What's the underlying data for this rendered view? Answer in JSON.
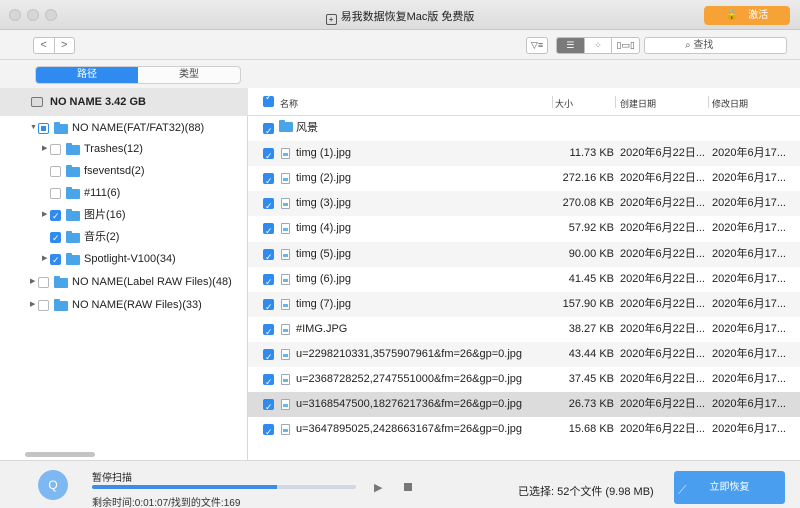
{
  "window": {
    "title": "易我数据恢复Mac版 免费版",
    "activate_label": "激活"
  },
  "toolbar": {
    "back": "<",
    "forward": ">",
    "filter_icon": "filter-icon",
    "view_modes": [
      "list-view-icon",
      "grid-view-icon",
      "column-view-icon"
    ],
    "search_placeholder": "查找"
  },
  "tabs": [
    "路径",
    "类型"
  ],
  "drive": {
    "label": "NO NAME 3.42 GB"
  },
  "tree": [
    {
      "label": "NO NAME(FAT/FAT32)(88)",
      "check": "partial",
      "expanded": true
    },
    {
      "label": "Trashes(12)",
      "check": "none",
      "expanded": false
    },
    {
      "label": "fseventsd(2)",
      "check": "none"
    },
    {
      "label": "#111(6)",
      "check": "none"
    },
    {
      "label": "图片(16)",
      "check": "on",
      "expanded": false
    },
    {
      "label": "音乐(2)",
      "check": "on"
    },
    {
      "label": "Spotlight-V100(34)",
      "check": "on",
      "expanded": false
    },
    {
      "label": "NO NAME(Label RAW Files)(48)",
      "check": "none",
      "expanded": false
    },
    {
      "label": "NO NAME(RAW Files)(33)",
      "check": "none",
      "expanded": false
    }
  ],
  "columns": {
    "name": "名称",
    "size": "大小",
    "created": "创建日期",
    "modified": "修改日期"
  },
  "files": [
    {
      "name": "风景",
      "type": "folder",
      "size": "",
      "created": "",
      "modified": ""
    },
    {
      "name": "timg (1).jpg",
      "type": "file",
      "size": "11.73 KB",
      "created": "2020年6月22日...",
      "modified": "2020年6月17..."
    },
    {
      "name": "timg (2).jpg",
      "type": "file",
      "size": "272.16 KB",
      "created": "2020年6月22日...",
      "modified": "2020年6月17..."
    },
    {
      "name": "timg (3).jpg",
      "type": "file",
      "size": "270.08 KB",
      "created": "2020年6月22日...",
      "modified": "2020年6月17..."
    },
    {
      "name": "timg (4).jpg",
      "type": "file",
      "size": "57.92 KB",
      "created": "2020年6月22日...",
      "modified": "2020年6月17..."
    },
    {
      "name": "timg (5).jpg",
      "type": "file",
      "size": "90.00 KB",
      "created": "2020年6月22日...",
      "modified": "2020年6月17..."
    },
    {
      "name": "timg (6).jpg",
      "type": "file",
      "size": "41.45 KB",
      "created": "2020年6月22日...",
      "modified": "2020年6月17..."
    },
    {
      "name": "timg (7).jpg",
      "type": "file",
      "size": "157.90 KB",
      "created": "2020年6月22日...",
      "modified": "2020年6月17..."
    },
    {
      "name": "#IMG.JPG",
      "type": "file",
      "size": "38.27 KB",
      "created": "2020年6月22日...",
      "modified": "2020年6月17..."
    },
    {
      "name": "u=2298210331,3575907961&fm=26&gp=0.jpg",
      "type": "file",
      "size": "43.44 KB",
      "created": "2020年6月22日...",
      "modified": "2020年6月17..."
    },
    {
      "name": "u=2368728252,2747551000&fm=26&gp=0.jpg",
      "type": "file",
      "size": "37.45 KB",
      "created": "2020年6月22日...",
      "modified": "2020年6月17..."
    },
    {
      "name": "u=3168547500,1827621736&fm=26&gp=0.jpg",
      "type": "file",
      "size": "26.73 KB",
      "created": "2020年6月22日...",
      "modified": "2020年6月17...",
      "selected": true
    },
    {
      "name": "u=3647895025,2428663167&fm=26&gp=0.jpg",
      "type": "file",
      "size": "15.68 KB",
      "created": "2020年6月22日...",
      "modified": "2020年6月17..."
    }
  ],
  "scan": {
    "status": "暂停扫描",
    "remaining": "剩余时间:0:01:07/找到的文件:169",
    "progress_fraction": 0.7
  },
  "footer": {
    "selected_text": "已选择: 52个文件 (9.98 MB)",
    "recover_label": "立即恢复"
  },
  "colors": {
    "accent": "#2f8bf0",
    "activate": "#f7a237",
    "recover": "#4a9ef0",
    "folder": "#4aa5e8"
  }
}
